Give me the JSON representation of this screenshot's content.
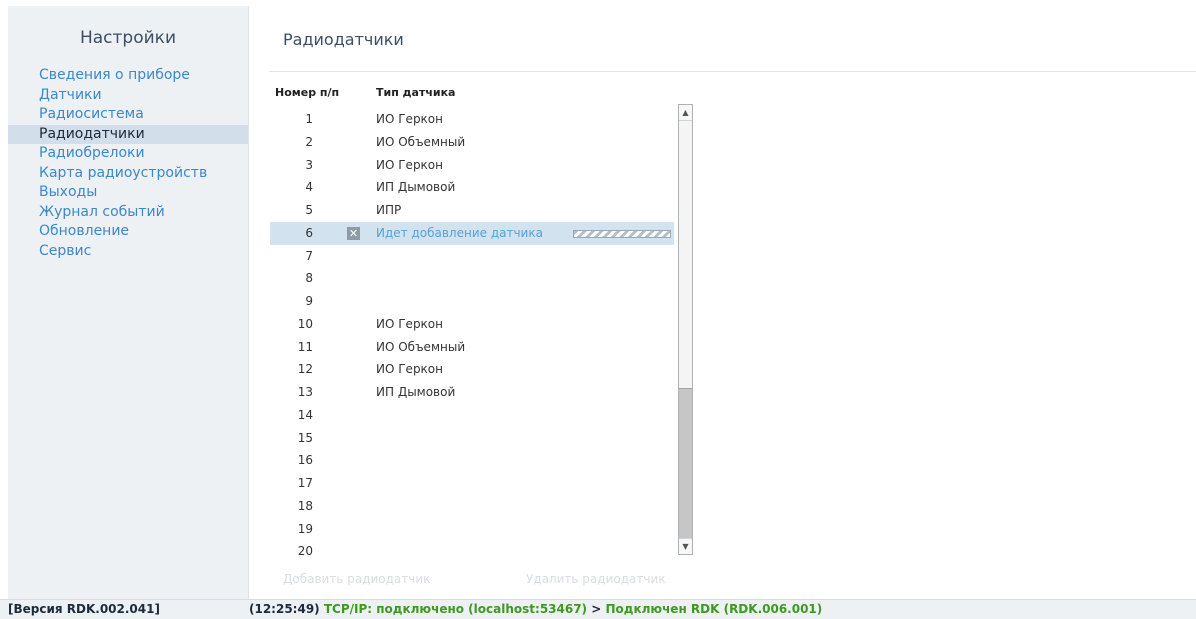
{
  "sidebar": {
    "title": "Настройки",
    "items": [
      {
        "label": "Сведения о приборе"
      },
      {
        "label": "Датчики"
      },
      {
        "label": "Радиосистема"
      },
      {
        "label": "Радиодатчики",
        "active": true
      },
      {
        "label": "Радиобрелоки"
      },
      {
        "label": "Карта радиоустройств"
      },
      {
        "label": "Выходы"
      },
      {
        "label": "Журнал событий"
      },
      {
        "label": "Обновление"
      },
      {
        "label": "Сервис"
      }
    ]
  },
  "main": {
    "title": "Радиодатчики",
    "columns": {
      "num": "Номер п/п",
      "type": "Тип датчика"
    },
    "rows": [
      {
        "num": "1",
        "type": "ИО Геркон"
      },
      {
        "num": "2",
        "type": "ИО Объемный"
      },
      {
        "num": "3",
        "type": "ИО Геркон"
      },
      {
        "num": "4",
        "type": "ИП Дымовой"
      },
      {
        "num": "5",
        "type": "ИПР"
      },
      {
        "num": "6",
        "type": "Идет добавление датчика",
        "adding": true
      },
      {
        "num": "7",
        "type": ""
      },
      {
        "num": "8",
        "type": ""
      },
      {
        "num": "9",
        "type": ""
      },
      {
        "num": "10",
        "type": "ИО Геркон"
      },
      {
        "num": "11",
        "type": "ИО Объемный"
      },
      {
        "num": "12",
        "type": "ИО Геркон"
      },
      {
        "num": "13",
        "type": "ИП Дымовой"
      },
      {
        "num": "14",
        "type": ""
      },
      {
        "num": "15",
        "type": ""
      },
      {
        "num": "16",
        "type": ""
      },
      {
        "num": "17",
        "type": ""
      },
      {
        "num": "18",
        "type": ""
      },
      {
        "num": "19",
        "type": ""
      },
      {
        "num": "20",
        "type": ""
      }
    ],
    "add_label": "Добавить радиодатчик",
    "delete_label": "Удалить радиодатчик"
  },
  "status": {
    "version": "[Версия RDK.002.041]",
    "time": "(12:25:49)",
    "tcp": "TCP/IP: подключено (localhost:53467)",
    "separator": ">",
    "device": "Подключен RDK (RDK.006.001)"
  },
  "colors": {
    "link": "#3b87c8",
    "selected_row": "#d2e2ef",
    "status_green": "#3c9a1e"
  }
}
